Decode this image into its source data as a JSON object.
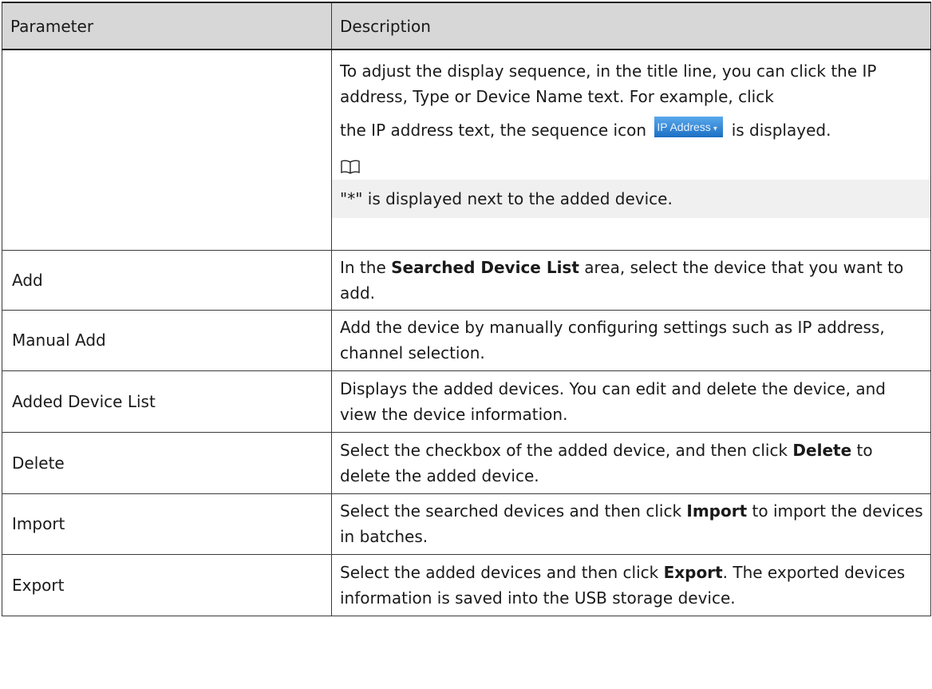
{
  "header": {
    "parameter": "Parameter",
    "description": "Description"
  },
  "rows": [
    {
      "parameter": "",
      "description_line1": "To adjust the display sequence, in the title line, you can click the IP address, Type or Device Name text. For example, click",
      "description_line2_before": "the IP address text, the sequence icon ",
      "sequence_icon_label": "IP Address",
      "description_line2_after": " is displayed.",
      "note_icon": "book-note-icon",
      "note_text": "\"*\" is displayed next to the added device."
    },
    {
      "parameter": "Add",
      "desc_before": "In the ",
      "desc_bold": "Searched Device List",
      "desc_after": "  area, select the device that you want to add."
    },
    {
      "parameter": "Manual Add",
      "description": "Add the device by manually configuring settings such as IP address, channel selection."
    },
    {
      "parameter": "Added Device List",
      "description": "Displays the added devices. You can edit and delete the device, and view the device information."
    },
    {
      "parameter": "Delete",
      "desc_before": "Select the checkbox of the added device, and then click ",
      "desc_bold": "Delete",
      "desc_after": "  to delete the added device."
    },
    {
      "parameter": "Import",
      "desc_before": "Select the searched devices and then click ",
      "desc_bold": "Import",
      "desc_after": "  to import the devices in batches."
    },
    {
      "parameter": "Export",
      "desc_before": "Select the added devices and then click ",
      "desc_bold": "Export",
      "desc_after": ". The exported devices information is saved into the USB storage device."
    }
  ]
}
